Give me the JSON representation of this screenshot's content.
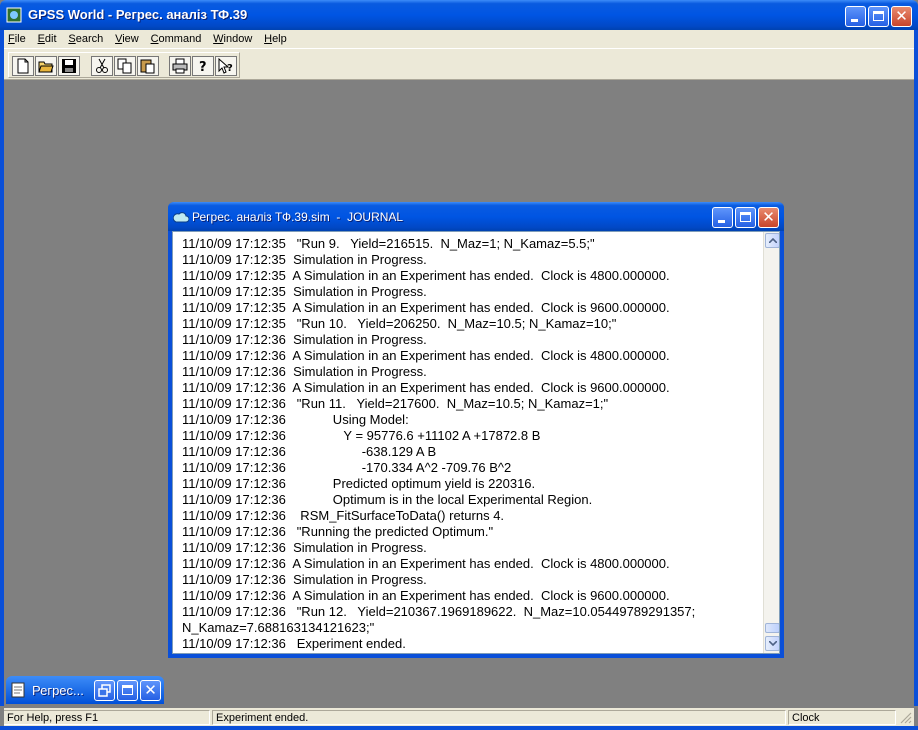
{
  "app": {
    "title": "GPSS World - Регрес. аналіз ТФ.39",
    "menu": [
      "File",
      "Edit",
      "Search",
      "View",
      "Command",
      "Window",
      "Help"
    ],
    "toolbar_icons": [
      "new-file-icon",
      "open-folder-icon",
      "save-icon",
      "cut-icon",
      "copy-icon",
      "paste-icon",
      "print-icon",
      "help-icon",
      "context-help-icon"
    ]
  },
  "journal_window": {
    "title": "Регрес. аналіз ТФ.39.sim  -  JOURNAL",
    "lines": [
      "11/10/09 17:12:35   \"Run 9.   Yield=216515.  N_Maz=1; N_Kamaz=5.5;\"",
      "11/10/09 17:12:35  Simulation in Progress.",
      "11/10/09 17:12:35  A Simulation in an Experiment has ended.  Clock is 4800.000000.",
      "11/10/09 17:12:35  Simulation in Progress.",
      "11/10/09 17:12:35  A Simulation in an Experiment has ended.  Clock is 9600.000000.",
      "11/10/09 17:12:35   \"Run 10.   Yield=206250.  N_Maz=10.5; N_Kamaz=10;\"",
      "11/10/09 17:12:36  Simulation in Progress.",
      "11/10/09 17:12:36  A Simulation in an Experiment has ended.  Clock is 4800.000000.",
      "11/10/09 17:12:36  Simulation in Progress.",
      "11/10/09 17:12:36  A Simulation in an Experiment has ended.  Clock is 9600.000000.",
      "11/10/09 17:12:36   \"Run 11.   Yield=217600.  N_Maz=10.5; N_Kamaz=1;\"",
      "11/10/09 17:12:36             Using Model:",
      "11/10/09 17:12:36                Y = 95776.6 +11102 A +17872.8 B",
      "11/10/09 17:12:36                     -638.129 A B",
      "11/10/09 17:12:36                     -170.334 A^2 -709.76 B^2",
      "11/10/09 17:12:36             Predicted optimum yield is 220316.",
      "11/10/09 17:12:36             Optimum is in the local Experimental Region.",
      "11/10/09 17:12:36    RSM_FitSurfaceToData() returns 4.",
      "11/10/09 17:12:36   \"Running the predicted Optimum.\"",
      "11/10/09 17:12:36  Simulation in Progress.",
      "11/10/09 17:12:36  A Simulation in an Experiment has ended.  Clock is 4800.000000.",
      "11/10/09 17:12:36  Simulation in Progress.",
      "11/10/09 17:12:36  A Simulation in an Experiment has ended.  Clock is 9600.000000.",
      "11/10/09 17:12:36   \"Run 12.   Yield=210367.1969189622.  N_Maz=10.05449789291357;",
      "N_Kamaz=7.688163134121623;\"",
      "11/10/09 17:12:36   Experiment ended."
    ]
  },
  "minimized_window": {
    "title": "Регрес..."
  },
  "statusbar": {
    "help": "For Help, press F1",
    "message": "Experiment ended.",
    "clock": "Clock"
  }
}
